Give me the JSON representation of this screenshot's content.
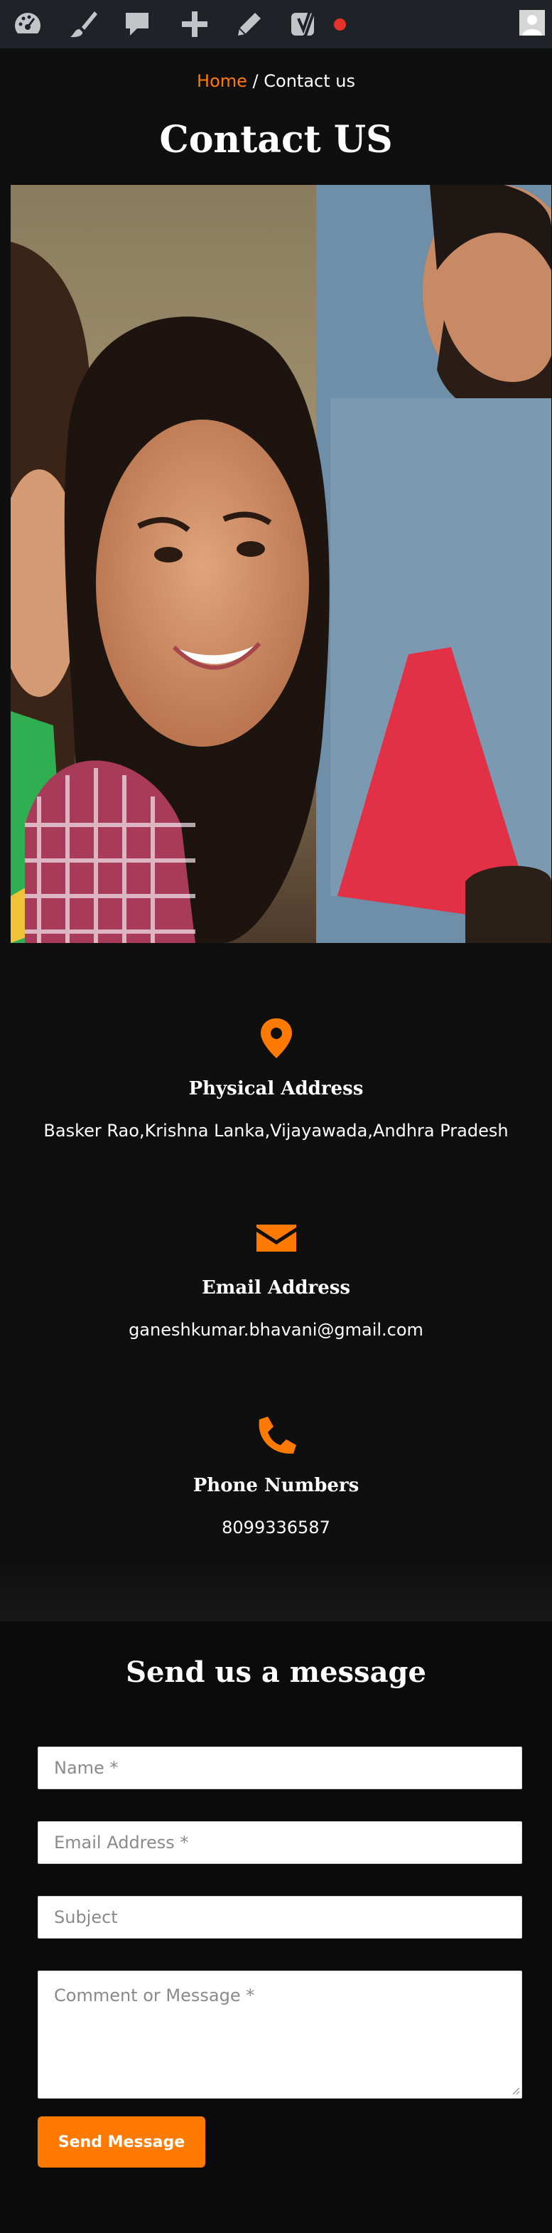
{
  "admin_bar": {
    "icons": [
      "dashboard-icon",
      "customize-icon",
      "comments-icon",
      "new-content-icon",
      "edit-icon",
      "yoast-seo-icon"
    ],
    "colors": {
      "background": "#1f2327",
      "icon": "#c3c4c7",
      "notification": "#e5322d"
    }
  },
  "breadcrumb": {
    "home": "Home",
    "separator": " / ",
    "current": "Contact us"
  },
  "page": {
    "title": "Contact US"
  },
  "contact_info": [
    {
      "icon": "map-marker-icon",
      "title": "Physical Address",
      "text": "Basker Rao,Krishna Lanka,Vijayawada,Andhra Pradesh"
    },
    {
      "icon": "envelope-icon",
      "title": "Email Address",
      "text": "ganeshkumar.bhavani@gmail.com"
    },
    {
      "icon": "phone-icon",
      "title": "Phone Numbers",
      "text": "8099336587"
    }
  ],
  "message_form": {
    "title": "Send us a message",
    "name_placeholder": "Name *",
    "email_placeholder": "Email Address *",
    "subject_placeholder": "Subject",
    "message_placeholder": "Comment or Message *",
    "submit_label": "Send Message"
  },
  "colors": {
    "accent": "#ff7a00",
    "background": "#0f0f0f",
    "text": "#ffffff"
  }
}
